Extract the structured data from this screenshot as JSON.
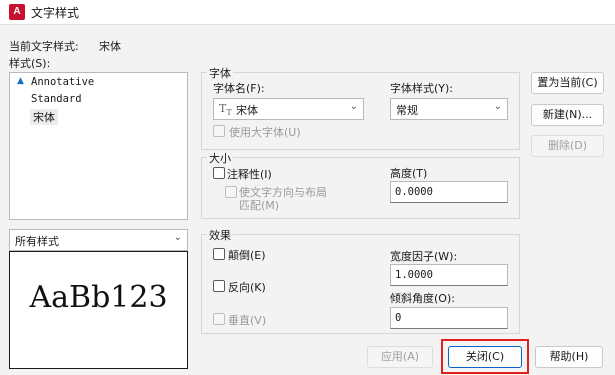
{
  "window": {
    "title": "文字样式",
    "app_icon_label": "A"
  },
  "current_style": {
    "label": "当前文字样式:",
    "value": "宋体"
  },
  "styles_label": "样式(S):",
  "styles_list": [
    "Annotative",
    "Standard",
    "宋体"
  ],
  "filter_combo": {
    "value": "所有样式"
  },
  "preview": {
    "text": "AaBb123"
  },
  "font_group": {
    "title": "字体",
    "font_name_label": "字体名(F):",
    "font_name_value": "宋体",
    "font_style_label": "字体样式(Y):",
    "font_style_value": "常规",
    "bigfont_label": "使用大字体(U)"
  },
  "size_group": {
    "title": "大小",
    "annotative_label": "注释性(I)",
    "match_orientation_line1": "使文字方向与布局",
    "match_orientation_line2": "匹配(M)",
    "height_label": "高度(T)",
    "height_value": "0.0000"
  },
  "effects_group": {
    "title": "效果",
    "upside_down_label": "颠倒(E)",
    "backwards_label": "反向(K)",
    "vertical_label": "垂直(V)",
    "width_factor_label": "宽度因子(W):",
    "width_factor_value": "1.0000",
    "oblique_label": "倾斜角度(O):",
    "oblique_value": "0"
  },
  "buttons": {
    "set_current": "置为当前(C)",
    "new": "新建(N)...",
    "delete": "删除(D)",
    "apply": "应用(A)",
    "close": "关闭(C)",
    "help": "帮助(H)"
  }
}
